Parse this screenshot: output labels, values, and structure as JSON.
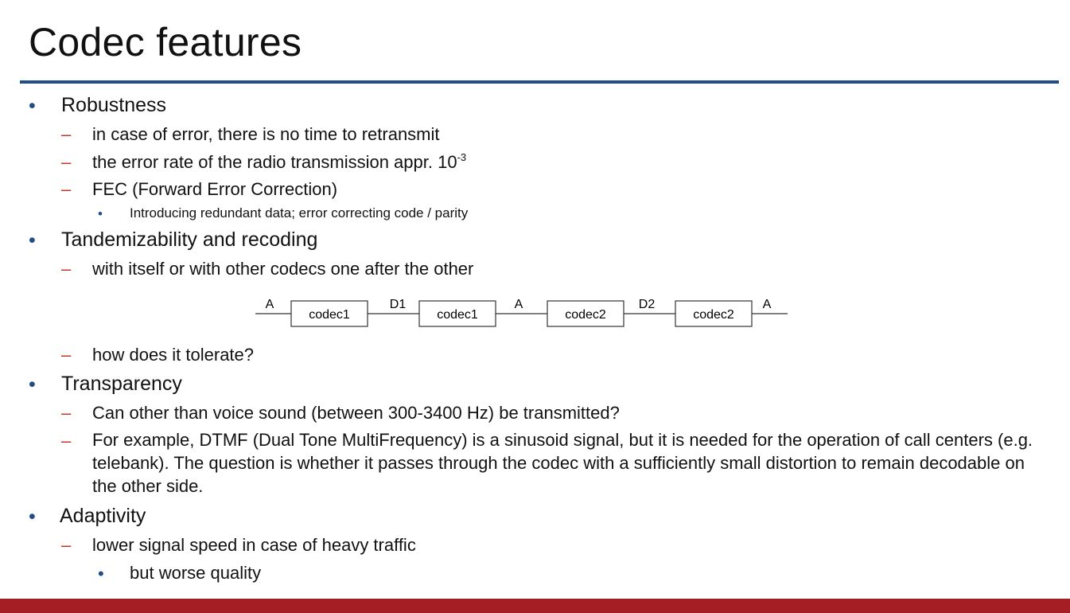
{
  "title": "Codec features",
  "sections": [
    {
      "heading": "Robustness",
      "items": [
        "in case of error, there is no time to retransmit",
        {
          "text": "the error rate of the radio transmission appr. 10",
          "sup": "-3"
        },
        "FEC (Forward Error Correction)"
      ],
      "subitem": "Introducing redundant data; error correcting code / parity"
    },
    {
      "heading": "Tandemizability and recoding",
      "items": [
        "with itself or with other codecs one after the other",
        "how does it tolerate?"
      ]
    },
    {
      "heading": "Transparency",
      "items": [
        "Can other than voice sound (between 300-3400 Hz) be transmitted?",
        "For example, DTMF (Dual Tone MultiFrequency) is a sinusoid signal, but it is needed for the operation of call centers (e.g. telebank). The question is whether it passes through the codec with a sufficiently small distortion to remain decodable on the other side."
      ]
    },
    {
      "heading": "Adaptivity",
      "items": [
        "lower signal speed in case of heavy traffic"
      ],
      "subitem": "but worse quality"
    }
  ],
  "diagram": {
    "boxes": [
      "codec1",
      "codec1",
      "codec2",
      "codec2"
    ],
    "signals": [
      "A",
      "D1",
      "A",
      "D2",
      "A"
    ]
  },
  "bullet_char": "•",
  "dash_char": "–",
  "colors": {
    "rule": "#1f4e87",
    "footer": "#a51e23",
    "dash": "#c0392b"
  }
}
